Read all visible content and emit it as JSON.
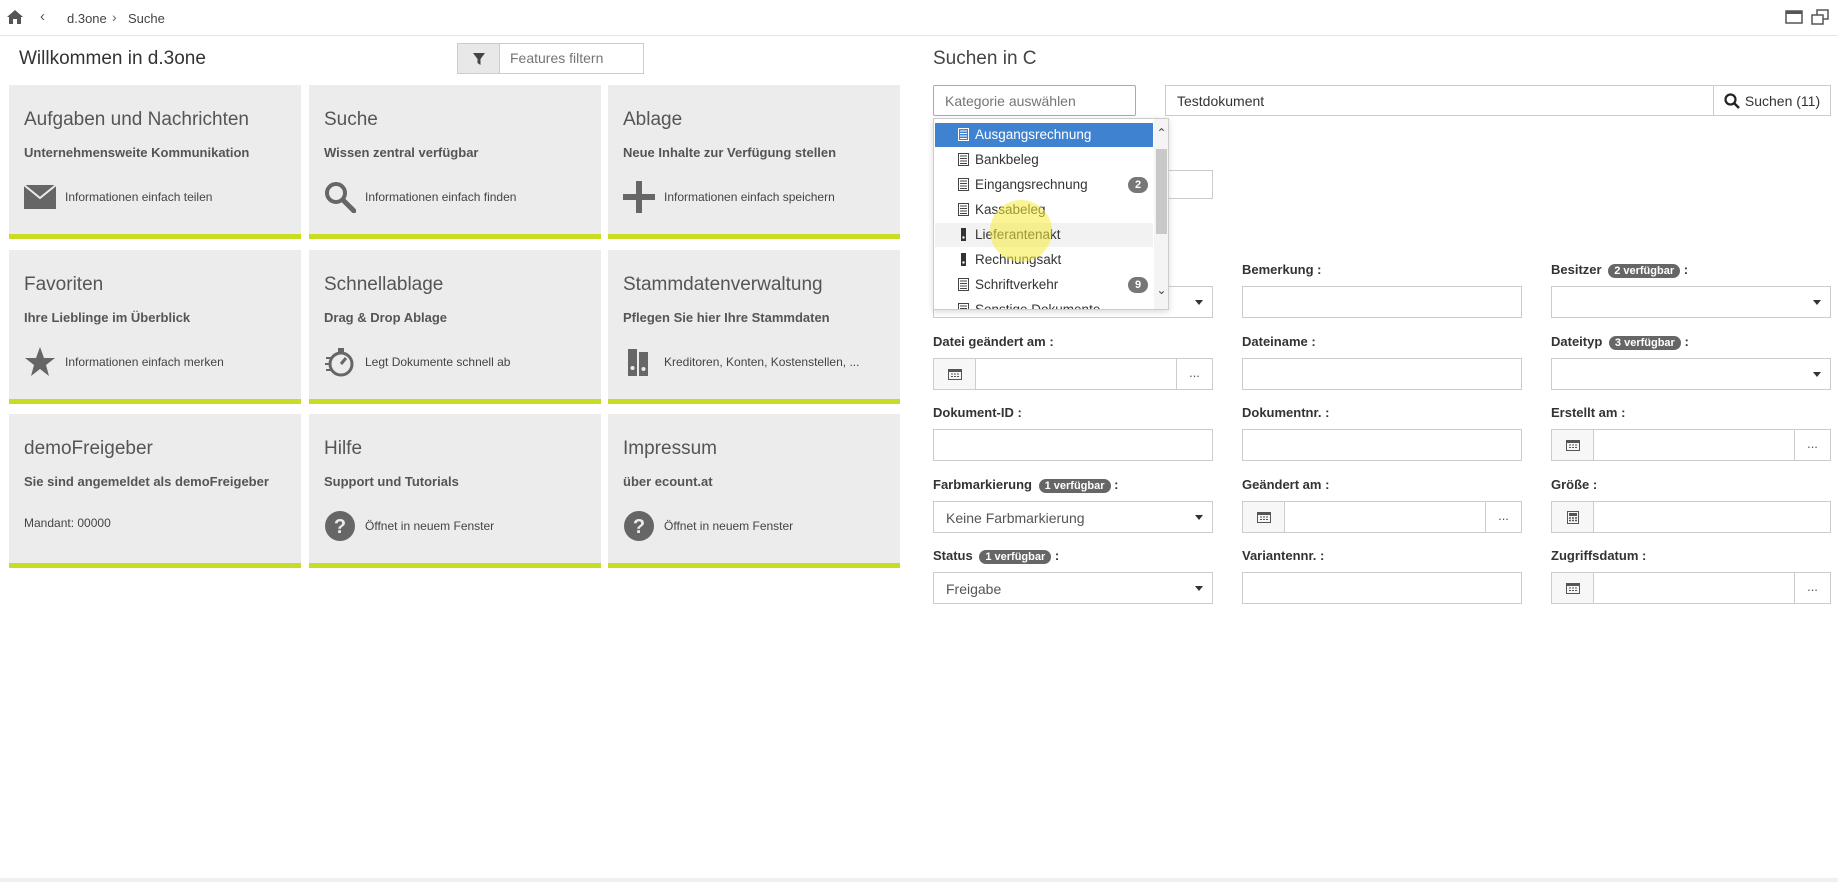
{
  "topbar": {
    "breadcrumb": [
      "d.3one",
      "Suche"
    ],
    "back_glyph": "‹",
    "separator_glyph": "›"
  },
  "left": {
    "title": "Willkommen in d.3one",
    "filter_placeholder": "Features filtern",
    "tiles": [
      {
        "title": "Aufgaben und Nachrichten",
        "subtitle": "Unternehmensweite Kommunikation",
        "icon": "envelope-icon",
        "desc": "Informationen einfach teilen"
      },
      {
        "title": "Suche",
        "subtitle": "Wissen zentral verfügbar",
        "icon": "search-icon",
        "desc": "Informationen einfach finden"
      },
      {
        "title": "Ablage",
        "subtitle": "Neue Inhalte zur Verfügung stellen",
        "icon": "plus-icon",
        "desc": "Informationen einfach speichern"
      },
      {
        "title": "Favoriten",
        "subtitle": "Ihre Lieblinge im Überblick",
        "icon": "star-icon",
        "desc": "Informationen einfach merken"
      },
      {
        "title": "Schnellablage",
        "subtitle": "Drag & Drop Ablage",
        "icon": "stopwatch-icon",
        "desc": "Legt Dokumente schnell ab"
      },
      {
        "title": "Stammdatenverwaltung",
        "subtitle": "Pflegen Sie hier Ihre Stammdaten",
        "icon": "binders-icon",
        "desc": "Kreditoren, Konten, Kostenstellen, ..."
      },
      {
        "title": "demoFreigeber",
        "subtitle": "Sie sind angemeldet als demoFreigeber",
        "icon": "",
        "desc": "Mandant: 00000"
      },
      {
        "title": "Hilfe",
        "subtitle": "Support und Tutorials",
        "icon": "question-icon",
        "desc": "Öffnet in neuem Fenster"
      },
      {
        "title": "Impressum",
        "subtitle": "über ecount.at",
        "icon": "question-icon",
        "desc": "Öffnet in neuem Fenster"
      }
    ]
  },
  "right": {
    "title": "Suchen in C",
    "category_placeholder": "Kategorie auswählen",
    "query_value": "Testdokument",
    "search_button": "Suchen (11)",
    "dropdown": [
      {
        "label": "Ausgangsrechnung",
        "icon": "document-icon",
        "badge": "",
        "state": "selected"
      },
      {
        "label": "Bankbeleg",
        "icon": "document-icon",
        "badge": ""
      },
      {
        "label": "Eingangsrechnung",
        "icon": "document-icon",
        "badge": "2"
      },
      {
        "label": "Kassabeleg",
        "icon": "document-icon",
        "badge": ""
      },
      {
        "label": "Lieferantenakt",
        "icon": "binder-icon",
        "badge": "",
        "state": "hover"
      },
      {
        "label": "Rechnungsakt",
        "icon": "binder-icon",
        "badge": ""
      },
      {
        "label": "Schriftverkehr",
        "icon": "document-icon",
        "badge": "9"
      },
      {
        "label": "Sonstige Dokumente",
        "icon": "document-icon",
        "badge": ""
      }
    ],
    "fields": {
      "bemerkung": "Bemerkung :",
      "besitzer": "Besitzer",
      "besitzer_badge": "2 verfügbar",
      "datei_geaendert": "Datei geändert am :",
      "dateiname": "Dateiname :",
      "dateityp": "Dateityp",
      "dateityp_badge": "3 verfügbar",
      "dokument_id": "Dokument-ID :",
      "dokumentnr": "Dokumentnr. :",
      "erstellt_am": "Erstellt am :",
      "farbmarkierung": "Farbmarkierung",
      "farbmarkierung_badge": "1 verfügbar",
      "farbmarkierung_value": "Keine Farbmarkierung",
      "geaendert_am": "Geändert am :",
      "groesse": "Größe :",
      "status": "Status",
      "status_badge": "1 verfügbar",
      "status_value": "Freigabe",
      "variantennr": "Variantennr. :",
      "zugriffsdatum": "Zugriffsdatum :",
      "colon": ":",
      "dots": "..."
    }
  }
}
